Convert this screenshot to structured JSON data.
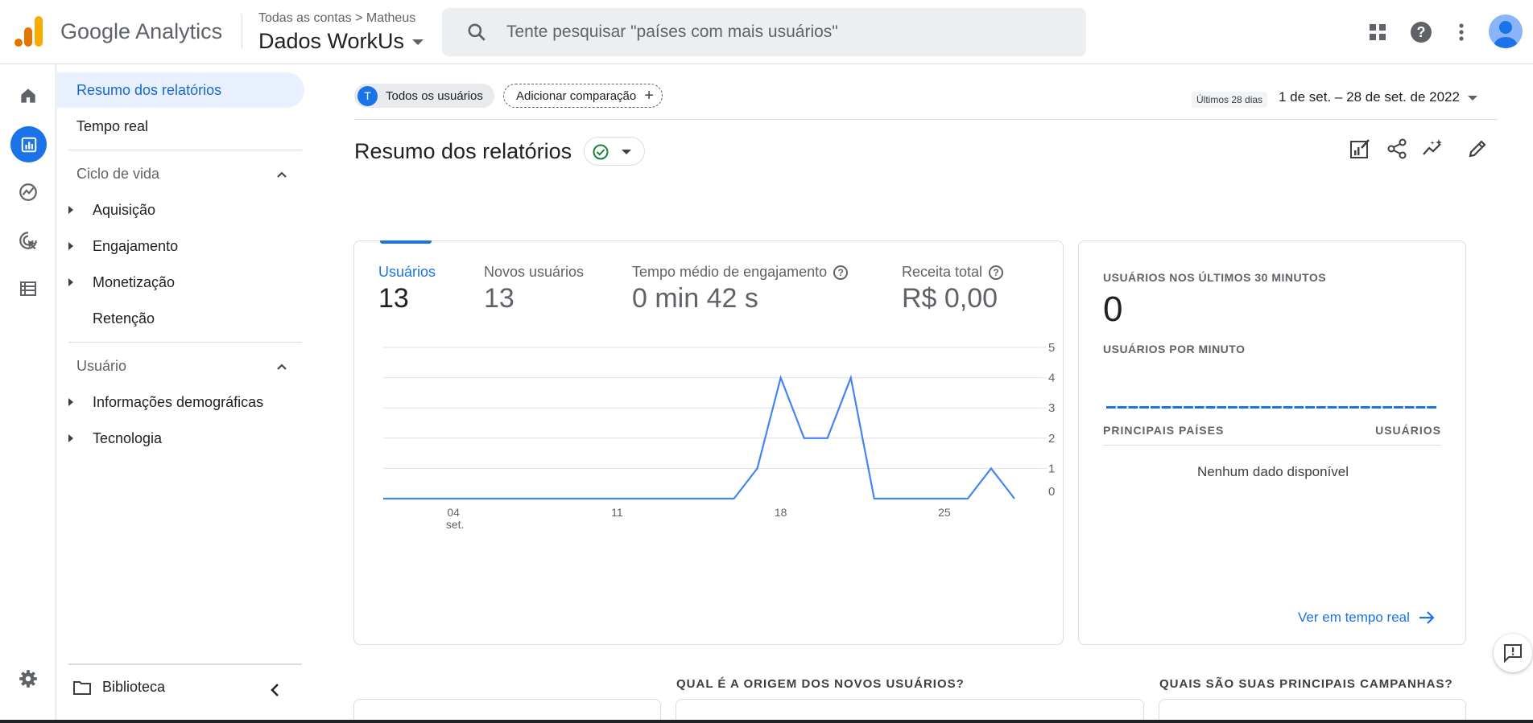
{
  "header": {
    "product_name": "Google Analytics",
    "breadcrumb": "Todas as contas  >  Matheus",
    "property_name": "Dados WorkUs",
    "search_placeholder": "Tente pesquisar \"países com mais usuários\""
  },
  "nav": {
    "reports_snapshot": "Resumo dos relatórios",
    "realtime": "Tempo real",
    "lifecycle_section": "Ciclo de vida",
    "lifecycle_items": [
      "Aquisição",
      "Engajamento",
      "Monetização"
    ],
    "retention": "Retenção",
    "user_section": "Usuário",
    "user_items": [
      "Informações demográficas",
      "Tecnologia"
    ],
    "library": "Biblioteca"
  },
  "filters": {
    "segment_initial": "T",
    "segment": "Todos os usuários",
    "add_comparison": "Adicionar comparação",
    "range_label": "Últimos 28 dias",
    "range": "1 de set. – 28 de set. de 2022"
  },
  "page": {
    "title": "Resumo dos relatórios"
  },
  "metrics": {
    "users_label": "Usuários",
    "users_value": "13",
    "new_users_label": "Novos usuários",
    "new_users_value": "13",
    "engagement_label": "Tempo médio de engajamento",
    "engagement_value": "0 min 42 s",
    "revenue_label": "Receita total",
    "revenue_value": "R$ 0,00"
  },
  "chart_data": {
    "type": "line",
    "series": [
      {
        "values": [
          0,
          0,
          0,
          0,
          0,
          0,
          0,
          0,
          0,
          0,
          0,
          0,
          0,
          0,
          0,
          0,
          1,
          4,
          2,
          2,
          4,
          0,
          0,
          0,
          0,
          0,
          1,
          0
        ]
      }
    ],
    "x": [
      1,
      2,
      3,
      4,
      5,
      6,
      7,
      8,
      9,
      10,
      11,
      12,
      13,
      14,
      15,
      16,
      17,
      18,
      19,
      20,
      21,
      22,
      23,
      24,
      25,
      26,
      27,
      28
    ],
    "x_ticks": [
      "04",
      "11",
      "18",
      "25"
    ],
    "x_tick_sub": "set.",
    "y_ticks": [
      "0",
      "1",
      "2",
      "3",
      "4",
      "5"
    ],
    "ylim": [
      0,
      5
    ],
    "line_color": "#4285f4",
    "grid": true
  },
  "realtime": {
    "title": "USUÁRIOS NOS ÚLTIMOS 30 MINUTOS",
    "value": "0",
    "per_minute": "USUÁRIOS POR MINUTO",
    "col_countries": "PRINCIPAIS PAÍSES",
    "col_users": "USUÁRIOS",
    "empty": "Nenhum dado disponível",
    "link": "Ver em tempo real"
  },
  "sections": {
    "new_users_origin": "QUAL É A ORIGEM DOS NOVOS USUÁRIOS?",
    "campaigns": "QUAIS SÃO SUAS PRINCIPAIS CAMPANHAS?"
  },
  "colors": {
    "accent": "#1a73e8",
    "logo_orange": "#f9ab00",
    "logo_dark_orange": "#e37400"
  }
}
